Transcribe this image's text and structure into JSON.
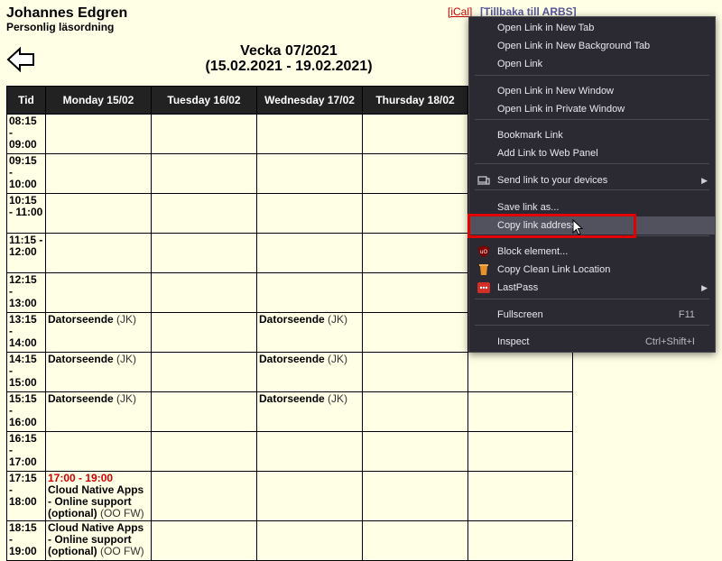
{
  "header": {
    "name": "Johannes Edgren",
    "subtitle": "Personlig läsordning",
    "ical": "[iCal]",
    "back_link": "[Tillbaka till ARBS]"
  },
  "week": {
    "line1": "Vecka 07/2021",
    "line2": "(15.02.2021 - 19.02.2021)"
  },
  "table": {
    "headers": [
      "Tid",
      "Monday 15/02",
      "Tuesday 16/02",
      "Wednesday 17/02",
      "Thursday 18/02",
      ""
    ],
    "rows": [
      {
        "time": "08:15 - 09:00"
      },
      {
        "time": "09:15 - 10:00"
      },
      {
        "time": "10:15 - 11:00"
      },
      {
        "time": "11:15 - 12:00"
      },
      {
        "time": "12:15 - 13:00"
      },
      {
        "time": "13:15 - 14:00",
        "mon": {
          "name": "Datorseende",
          "who": "(JK)"
        },
        "wed": {
          "name": "Datorseende",
          "who": "(JK)"
        }
      },
      {
        "time": "14:15 - 15:00",
        "mon": {
          "name": "Datorseende",
          "who": "(JK)"
        },
        "wed": {
          "name": "Datorseende",
          "who": "(JK)"
        }
      },
      {
        "time": "15:15 - 16:00",
        "mon": {
          "name": "Datorseende",
          "who": "(JK)"
        },
        "wed": {
          "name": "Datorseende",
          "who": "(JK)"
        }
      },
      {
        "time": "16:15 - 17:00"
      },
      {
        "time": "17:15 - 18:00",
        "mon": {
          "time": "17:00 - 19:00",
          "name": "Cloud Native Apps - Online support (optional)",
          "who": "(OO FW)"
        }
      },
      {
        "time": "18:15 - 19:00",
        "mon": {
          "name": "Cloud Native Apps - Online support (optional)",
          "who": "(OO FW)"
        }
      }
    ]
  },
  "context_menu": {
    "items": [
      {
        "label": "Open Link in New Tab"
      },
      {
        "label": "Open Link in New Background Tab"
      },
      {
        "label": "Open Link"
      },
      {
        "label": "Open Link in New Window"
      },
      {
        "label": "Open Link in Private Window"
      },
      {
        "label": "Bookmark Link"
      },
      {
        "label": "Add Link to Web Panel"
      },
      {
        "label": "Send link to your devices"
      },
      {
        "label": "Save link as..."
      },
      {
        "label": "Copy link address"
      },
      {
        "label": "Block element..."
      },
      {
        "label": "Copy Clean Link Location"
      },
      {
        "label": "LastPass"
      },
      {
        "label": "Fullscreen",
        "shortcut": "F11"
      },
      {
        "label": "Inspect",
        "shortcut": "Ctrl+Shift+I"
      }
    ]
  },
  "colors": {
    "page_bg": "#ffffe6",
    "header_bg": "#222222",
    "menu_bg": "#2b2a33",
    "highlight_box": "#e10000"
  }
}
